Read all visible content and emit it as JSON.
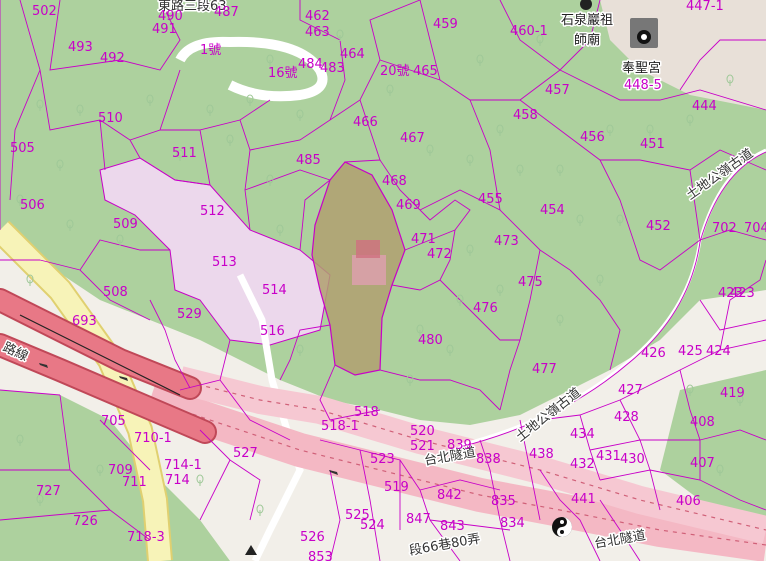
{
  "map": {
    "colors": {
      "forest": "#add19e",
      "parcel_line": "#c800c8",
      "highlight_parcel": "#b0a070",
      "light_parcel": "#ecd8ec",
      "road_pink": "#f4b8c4",
      "road_red": "#e06877",
      "road_yellow": "#f7f3b8",
      "background": "#f2efe9"
    },
    "parcel_labels": [
      "502",
      "490",
      "487",
      "491",
      "462",
      "463",
      "459",
      "460-1",
      "447-1",
      "493",
      "492",
      "1號",
      "16號",
      "484",
      "483",
      "464",
      "20號",
      "465",
      "510",
      "466",
      "467",
      "485",
      "505",
      "511",
      "468",
      "469",
      "457",
      "458",
      "456",
      "451",
      "444",
      "506",
      "509",
      "512",
      "455",
      "454",
      "452",
      "471",
      "472",
      "473",
      "702",
      "704",
      "513",
      "514",
      "475",
      "423",
      "508",
      "529",
      "516",
      "476",
      "480",
      "426",
      "425",
      "424",
      "419",
      "693",
      "477",
      "427",
      "428",
      "408",
      "518",
      "518-1",
      "520",
      "521",
      "839",
      "838",
      "434",
      "432",
      "431",
      "430",
      "407",
      "705",
      "710-1",
      "709",
      "711",
      "714-1",
      "714",
      "527",
      "523",
      "438",
      "441",
      "406",
      "727",
      "519",
      "524",
      "842",
      "835",
      "726",
      "525",
      "847",
      "843",
      "834",
      "718-3",
      "526",
      "853",
      "423"
    ],
    "road_labels": {
      "road_section": "東路三段63",
      "ancient_trail": "土地公嶺古道",
      "ancient_trail_2": "土地公嶺古道",
      "tunnel_1": "台北隧道",
      "tunnel_2": "台北隧道",
      "lane": "段66巷80弄",
      "line": "路線"
    },
    "places": {
      "temple_1": "石泉巖祖",
      "temple_1b": "師廟",
      "temple_2": "奉聖宮",
      "temple_2_lot": "448-5"
    },
    "icons": [
      "temple-icon",
      "yin-yang-icon",
      "tree-icon",
      "one-way-arrow-icon"
    ]
  }
}
